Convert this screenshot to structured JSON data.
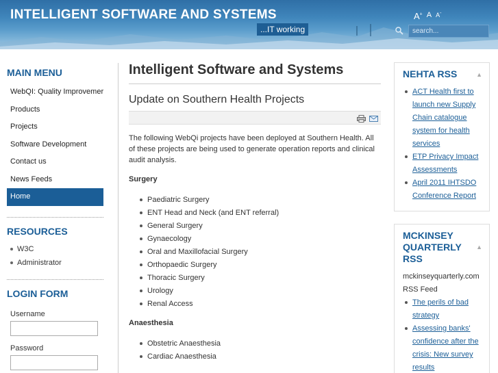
{
  "header": {
    "title": "INTELLIGENT SOFTWARE AND SYSTEMS",
    "tagline": "...IT working",
    "font_tools": {
      "increase": "A",
      "reset": "A",
      "decrease": "A"
    },
    "search_placeholder": "search..."
  },
  "main_menu": {
    "title": "MAIN MENU",
    "items": [
      {
        "label": "WebQI: Quality Improvemer"
      },
      {
        "label": "Products"
      },
      {
        "label": "Projects"
      },
      {
        "label": "Software Development"
      },
      {
        "label": "Contact us"
      },
      {
        "label": "News Feeds"
      },
      {
        "label": "Home",
        "active": true
      }
    ]
  },
  "resources": {
    "title": "RESOURCES",
    "items": [
      {
        "label": "W3C"
      },
      {
        "label": "Administrator"
      }
    ]
  },
  "login": {
    "title": "LOGIN FORM",
    "username_label": "Username",
    "password_label": "Password"
  },
  "article": {
    "page_title": "Intelligent Software and Systems",
    "heading": "Update on Southern Health Projects",
    "intro": "The following WebQi projects have been deployed at Southern Health. All of these projects are being used to generate operation reports and clinical audit analysis.",
    "surgery_head": "Surgery",
    "surgery_items": [
      "Paediatric Surgery",
      "ENT Head and Neck (and ENT referral)",
      "General Surgery",
      "Gynaecology",
      "Oral and Maxillofacial Surgery",
      "Orthopaedic Surgery",
      "Thoracic Surgery",
      "Urology",
      "Renal Access"
    ],
    "anaesthesia_head": "Anaesthesia",
    "anaesthesia_items": [
      "Obstetric Anaesthesia",
      "Cardiac Anaesthesia"
    ]
  },
  "nehta": {
    "title": "NEHTA RSS",
    "items": [
      "ACT Health first to launch new Supply Chain catalogue system for health services",
      "ETP Privacy Impact Assessments",
      "April 2011 IHTSDO Conference Report"
    ]
  },
  "mckinsey": {
    "title": "MCKINSEY QUARTERLY RSS",
    "description": "mckinseyquarterly.com RSS Feed",
    "items": [
      "The perils of bad strategy",
      "Assessing banks' confidence after the crisis: New survey results"
    ]
  },
  "colors": {
    "accent": "#1b5e97",
    "header_top": "#2f6fa6"
  }
}
